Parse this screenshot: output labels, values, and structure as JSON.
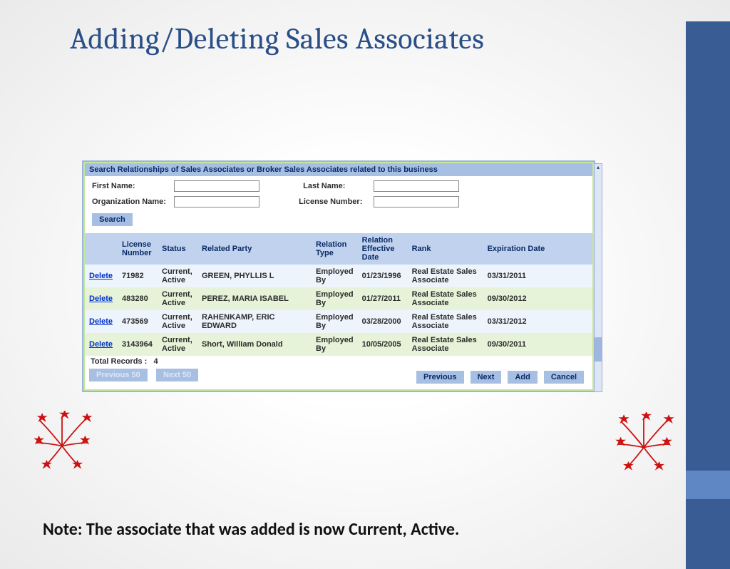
{
  "slide": {
    "title": "Adding/Deleting Sales Associates",
    "note": "Note: The associate that was added is now Current, Active."
  },
  "panel": {
    "header": "Search Relationships of Sales Associates or Broker Sales Associates related to this business",
    "labels": {
      "first_name": "First Name:",
      "last_name": "Last Name:",
      "org_name": "Organization Name:",
      "license_number": "License Number:"
    },
    "buttons": {
      "search": "Search",
      "prev50": "Previous 50",
      "next50": "Next 50",
      "previous": "Previous",
      "next": "Next",
      "add": "Add",
      "cancel": "Cancel",
      "delete": "Delete"
    },
    "totals_label": "Total Records :",
    "totals_value": "4",
    "columns": [
      "",
      "License Number",
      "Status",
      "Related Party",
      "Relation Type",
      "Relation Effective Date",
      "Rank",
      "Expiration Date"
    ],
    "rows": [
      {
        "license": "71982",
        "status": "Current, Active",
        "party": "GREEN, PHYLLIS L",
        "rtype": "Employed By",
        "effdate": "01/23/1996",
        "rank": "Real Estate Sales Associate",
        "exp": "03/31/2011"
      },
      {
        "license": "483280",
        "status": "Current, Active",
        "party": "PEREZ, MARIA ISABEL",
        "rtype": "Employed By",
        "effdate": "01/27/2011",
        "rank": "Real Estate Sales Associate",
        "exp": "09/30/2012"
      },
      {
        "license": "473569",
        "status": "Current, Active",
        "party": "RAHENKAMP, ERIC EDWARD",
        "rtype": "Employed By",
        "effdate": "03/28/2000",
        "rank": "Real Estate Sales Associate",
        "exp": "03/31/2012"
      },
      {
        "license": "3143964",
        "status": "Current, Active",
        "party": "Short, William Donald",
        "rtype": "Employed By",
        "effdate": "10/05/2005",
        "rank": "Real Estate Sales Associate",
        "exp": "09/30/2011"
      }
    ]
  }
}
